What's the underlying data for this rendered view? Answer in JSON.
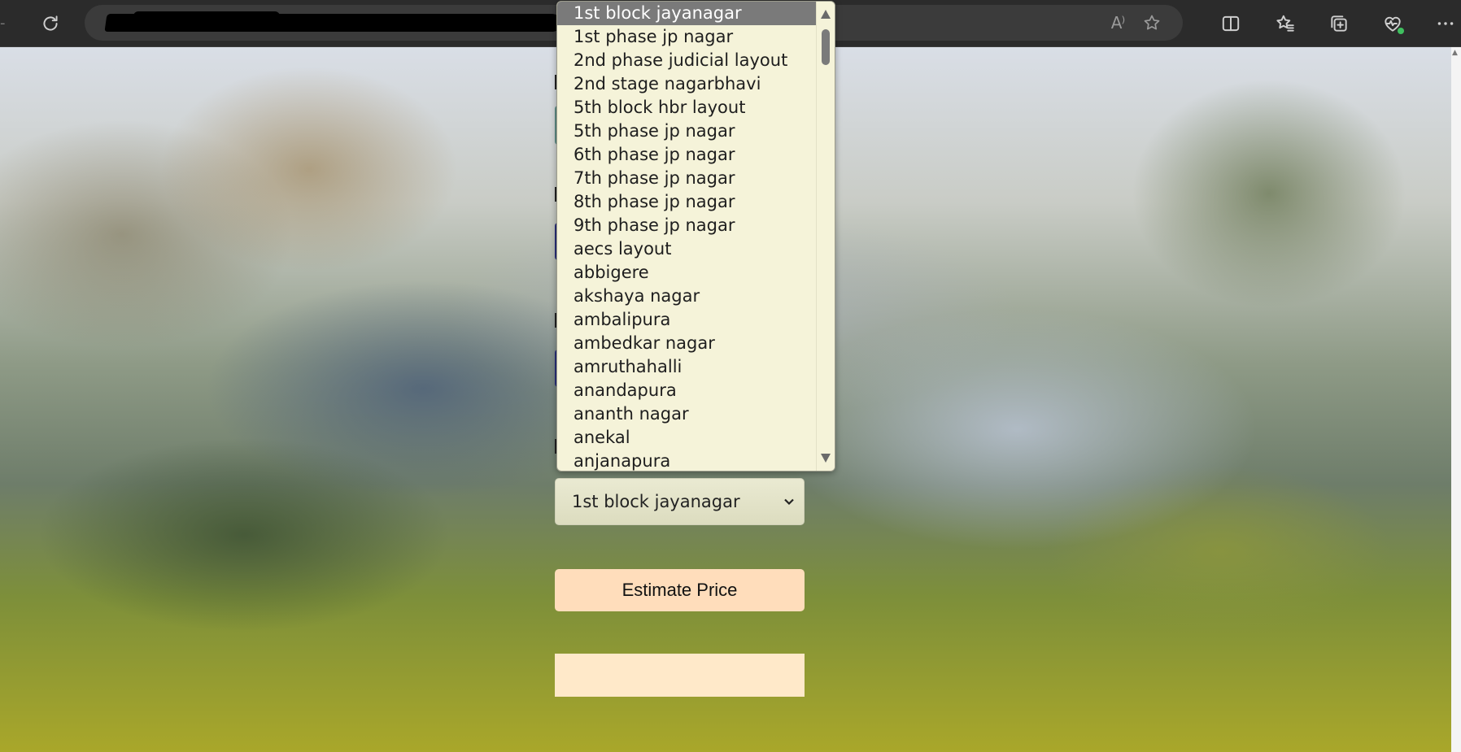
{
  "browser": {
    "toolbar_icons": [
      "refresh-icon",
      "read-aloud-icon",
      "favorite-star-icon",
      "split-screen-icon",
      "favorites-icon",
      "collections-icon",
      "browser-essentials-icon",
      "more-options-icon"
    ],
    "read_aloud_glyph": "A⁾"
  },
  "form": {
    "location_select_value": "1st block jayanagar",
    "estimate_button_label": "Estimate Price",
    "result_text": ""
  },
  "dropdown": {
    "selected_index": 0,
    "options": [
      "1st block jayanagar",
      "1st phase jp nagar",
      "2nd phase judicial layout",
      "2nd stage nagarbhavi",
      "5th block hbr layout",
      "5th phase jp nagar",
      "6th phase jp nagar",
      "7th phase jp nagar",
      "8th phase jp nagar",
      "9th phase jp nagar",
      "aecs layout",
      "abbigere",
      "akshaya nagar",
      "ambalipura",
      "ambedkar nagar",
      "amruthahalli",
      "anandapura",
      "ananth nagar",
      "anekal",
      "anjanapura"
    ]
  },
  "colors": {
    "dropdown_bg": "#f5f3d9",
    "selected_option_bg": "#7a7a7a",
    "button_bg": "#ffddbb",
    "result_bg": "#ffe9c9",
    "browser_chrome": "#2b2b2b"
  }
}
